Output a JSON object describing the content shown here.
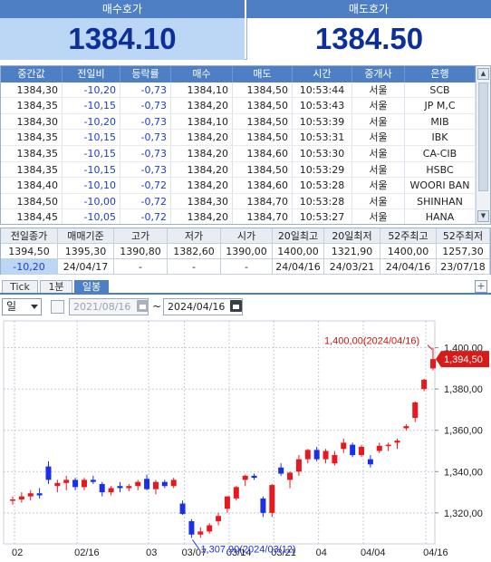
{
  "quotes": {
    "bid_label": "매수호가",
    "bid_value": "1384.10",
    "ask_label": "매도호가",
    "ask_value": "1384.50"
  },
  "trades": {
    "headers": [
      "중간값",
      "전일비",
      "등락률",
      "매수",
      "매도",
      "시간",
      "중개사",
      "은행"
    ],
    "rows": [
      [
        "1384,30",
        "-10,20",
        "-0,73",
        "1384,10",
        "1384,50",
        "10:53:44",
        "서울",
        "SCB"
      ],
      [
        "1384,35",
        "-10,15",
        "-0,73",
        "1384,20",
        "1384,50",
        "10:53:43",
        "서울",
        "JP M,C"
      ],
      [
        "1384,30",
        "-10,20",
        "-0,73",
        "1384,10",
        "1384,50",
        "10:53:39",
        "서울",
        "MIB"
      ],
      [
        "1384,35",
        "-10,15",
        "-0,73",
        "1384,20",
        "1384,50",
        "10:53:31",
        "서울",
        "IBK"
      ],
      [
        "1384,35",
        "-10,15",
        "-0,73",
        "1384,20",
        "1384,60",
        "10:53:30",
        "서울",
        "CA-CIB"
      ],
      [
        "1384,35",
        "-10,15",
        "-0,73",
        "1384,20",
        "1384,50",
        "10:53:29",
        "서울",
        "HSBC"
      ],
      [
        "1384,40",
        "-10,10",
        "-0,72",
        "1384,20",
        "1384,60",
        "10:53:28",
        "서울",
        "WOORI BAN"
      ],
      [
        "1384,50",
        "-10,00",
        "-0,72",
        "1384,30",
        "1384,70",
        "10:53:28",
        "서울",
        "SHINHAN"
      ],
      [
        "1384,45",
        "-10,05",
        "-0,72",
        "1384,20",
        "1384,70",
        "10:53:27",
        "서울",
        "HANA"
      ]
    ]
  },
  "summary": {
    "headers": [
      "전일종가",
      "매매기준",
      "고가",
      "저가",
      "시가",
      "20일최고",
      "20일최저",
      "52주최고",
      "52주최저"
    ],
    "row1": [
      "1394,50",
      "1395,30",
      "1390,80",
      "1382,60",
      "1390,00",
      "1400,00",
      "1321,90",
      "1400,00",
      "1257,30"
    ],
    "row2": [
      "-10,20",
      "24/04/17",
      "-",
      "-",
      "-",
      "24/04/16",
      "24/03/21",
      "24/04/16",
      "23/07/18"
    ]
  },
  "tabs": [
    "Tick",
    "1분",
    "일봉"
  ],
  "controls": {
    "period": "일",
    "start_date": "2021/08/16",
    "separator": "~",
    "end_date": "2024/04/16"
  },
  "chart_data": {
    "type": "candlestick",
    "ylim": [
      1305,
      1413
    ],
    "y_ticks": [
      1320,
      1340,
      1360,
      1380,
      1400
    ],
    "y_tick_labels": [
      "1,320,00",
      "1,340,00",
      "1,360,00",
      "1,380,00",
      "1,400,00"
    ],
    "x_tick_labels": [
      "02",
      "02/16",
      "03",
      "03/07",
      "03/14",
      "03/21",
      "04",
      "04/04",
      "04/16"
    ],
    "x_tick_index": [
      0,
      7,
      15,
      19,
      24,
      29,
      34,
      39,
      46
    ],
    "current_price_label": "1,394,50",
    "current_price": 1394.5,
    "high_annotation": "1,400,00(2024/04/16)",
    "low_annotation": "1,307,90(2024/03/12)",
    "high_value": 1400.0,
    "low_value": 1307.9,
    "up_color": "#e8181e",
    "down_color": "#1b2fe6",
    "candles": [
      [
        1326.0,
        1328.0,
        1324.0,
        1326.5
      ],
      [
        1326.5,
        1330.0,
        1325.0,
        1328.0
      ],
      [
        1328.0,
        1331.0,
        1326.0,
        1329.5
      ],
      [
        1329.5,
        1332.0,
        1327.0,
        1328.5
      ],
      [
        1342.5,
        1345.0,
        1334.0,
        1336.0
      ],
      [
        1333.0,
        1336.0,
        1330.0,
        1334.5
      ],
      [
        1334.5,
        1338.0,
        1331.0,
        1336.0
      ],
      [
        1336.0,
        1337.0,
        1331.0,
        1332.5
      ],
      [
        1332.5,
        1337.0,
        1331.0,
        1336.0
      ],
      [
        1336.0,
        1338.0,
        1334.0,
        1335.0
      ],
      [
        1334.0,
        1335.0,
        1328.0,
        1330.0
      ],
      [
        1330.0,
        1333.0,
        1328.5,
        1332.0
      ],
      [
        1333.0,
        1335.0,
        1330.0,
        1332.0
      ],
      [
        1332.0,
        1334.0,
        1330.5,
        1333.0
      ],
      [
        1333.0,
        1336.0,
        1331.0,
        1335.0
      ],
      [
        1336.5,
        1338.5,
        1331.0,
        1331.5
      ],
      [
        1331.5,
        1336.0,
        1329.0,
        1335.0
      ],
      [
        1335.0,
        1336.0,
        1332.0,
        1333.0
      ],
      [
        1333.0,
        1337.0,
        1332.0,
        1336.0
      ],
      [
        1324.5,
        1326.0,
        1319.0,
        1319.5
      ],
      [
        1316.0,
        1317.0,
        1307.9,
        1309.5
      ],
      [
        1309.5,
        1313.0,
        1308.0,
        1311.0
      ],
      [
        1311.0,
        1315.0,
        1310.0,
        1314.0
      ],
      [
        1316.0,
        1320.0,
        1314.0,
        1318.5
      ],
      [
        1322.0,
        1328.0,
        1320.0,
        1328.0
      ],
      [
        1327.0,
        1333.0,
        1326.0,
        1332.5
      ],
      [
        1336.0,
        1338.5,
        1333.0,
        1338.0
      ],
      [
        1338.0,
        1339.0,
        1336.0,
        1337.0
      ],
      [
        1327.0,
        1328.0,
        1318.0,
        1320.0
      ],
      [
        1320.0,
        1334.0,
        1318.0,
        1333.5
      ],
      [
        1342.0,
        1344.0,
        1338.0,
        1339.0
      ],
      [
        1336.0,
        1340.0,
        1332.0,
        1339.5
      ],
      [
        1340.0,
        1348.0,
        1338.0,
        1346.0
      ],
      [
        1346.0,
        1351.0,
        1344.0,
        1350.5
      ],
      [
        1350.5,
        1352.0,
        1345.0,
        1346.0
      ],
      [
        1346.0,
        1351.0,
        1344.0,
        1350.0
      ],
      [
        1344.0,
        1350.0,
        1343.0,
        1348.0
      ],
      [
        1351.0,
        1356.0,
        1349.0,
        1354.0
      ],
      [
        1353.0,
        1354.0,
        1347.0,
        1348.0
      ],
      [
        1348.0,
        1353.0,
        1347.0,
        1352.0
      ],
      [
        1346.0,
        1348.0,
        1342.0,
        1343.5
      ],
      [
        1350.0,
        1354.0,
        1349.0,
        1352.5
      ],
      [
        1352.5,
        1354.0,
        1350.0,
        1353.0
      ],
      [
        1354.0,
        1356.0,
        1351.0,
        1355.0
      ],
      [
        1361.0,
        1363.0,
        1360.0,
        1362.0
      ],
      [
        1366.0,
        1374.0,
        1364.0,
        1373.5
      ],
      [
        1380.0,
        1385.0,
        1379.0,
        1384.5
      ],
      [
        1390.0,
        1400.0,
        1389.0,
        1394.5
      ]
    ]
  }
}
